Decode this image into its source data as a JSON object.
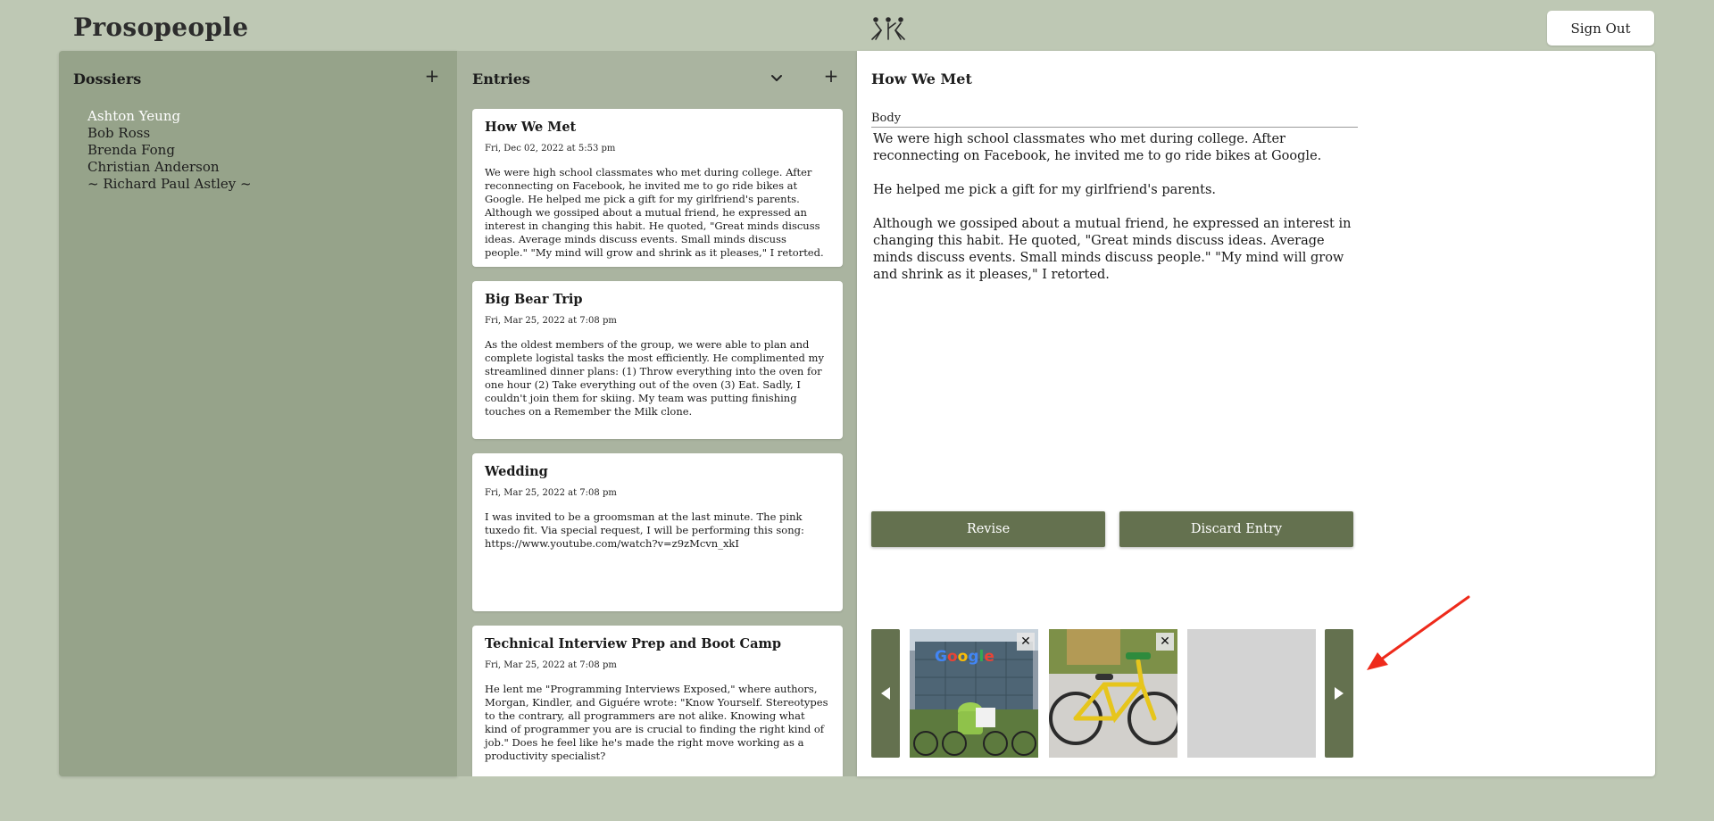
{
  "app": {
    "brand": "Prosopeople",
    "sign_out": "Sign Out"
  },
  "dossiers": {
    "title": "Dossiers",
    "add": "+",
    "items": [
      "Ashton Yeung",
      "Bob Ross",
      "Brenda Fong",
      "Christian Anderson",
      "~ Richard Paul Astley ~"
    ],
    "active_index": 0
  },
  "entries": {
    "title": "Entries",
    "add": "+",
    "items": [
      {
        "title": "How We Met",
        "date": "Fri, Dec 02, 2022 at 5:53 pm",
        "body": "We were high school classmates who met during college. After reconnecting on Facebook, he invited me to go ride bikes at Google. He helped me pick a gift for my girlfriend's parents. Although we gossiped about a mutual friend, he expressed an interest in changing this habit. He quoted, \"Great minds discuss ideas. Average minds discuss events. Small minds discuss people.\" \"My mind will grow and shrink as it pleases,\" I retorted."
      },
      {
        "title": "Big Bear Trip",
        "date": "Fri, Mar 25, 2022 at 7:08 pm",
        "body": "As the oldest members of the group, we were able to plan and complete logistal tasks the most efficiently. He complimented my streamlined dinner plans: (1) Throw everything into the oven for one hour (2) Take everything out of the oven (3) Eat. Sadly, I couldn't join them for skiing. My team was putting finishing touches on a Remember the Milk clone."
      },
      {
        "title": "Wedding",
        "date": "Fri, Mar 25, 2022 at 7:08 pm",
        "body": "I was invited to be a groomsman at the last minute. The pink tuxedo fit. Via special request, I will be performing this song: https://www.youtube.com/watch?v=z9zMcvn_xkI"
      },
      {
        "title": "Technical Interview Prep and Boot Camp",
        "date": "Fri, Mar 25, 2022 at 7:08 pm",
        "body": "He lent me \"Programming Interviews Exposed,\" where authors, Morgan, Kindler, and Giguére wrote: \"Know Yourself. Stereotypes to the contrary, all programmers are not alike. Knowing what kind of programmer you are is crucial to finding the right kind of job.\" Does he feel like he's made the right move working as a productivity specialist?"
      }
    ]
  },
  "detail": {
    "title": "How We Met",
    "body_label": "Body",
    "paragraphs": [
      "We were high school classmates who met during college. After reconnecting on Facebook, he invited me to go ride bikes at Google.",
      "He helped me pick a gift for my girlfriend's parents.",
      "Although we gossiped about a mutual friend, he expressed an interest in changing this habit. He quoted, \"Great minds discuss ideas. Average minds discuss events. Small minds discuss people.\" \"My mind will grow and shrink as it pleases,\" I retorted."
    ],
    "revise": "Revise",
    "discard": "Discard Entry",
    "photo_remove": "✕",
    "photos": [
      "google-campus-photo",
      "yellow-bicycle-photo",
      "empty-photo-slot"
    ]
  },
  "colors": {
    "background": "#bec8b4",
    "dossier_panel": "#96a38a",
    "entries_panel": "#aab4a0",
    "accent": "#64714f",
    "annotation_arrow": "#ee2a1b"
  }
}
